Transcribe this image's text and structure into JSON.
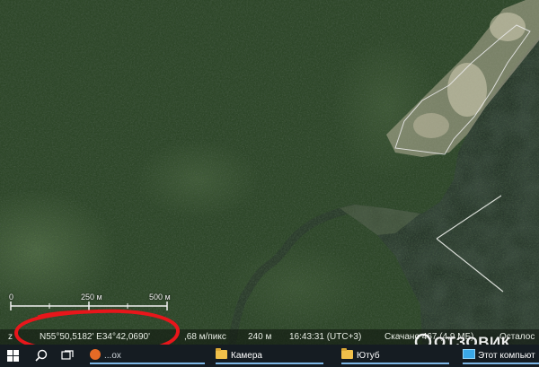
{
  "map": {
    "scale_bar": {
      "tick_0": "0",
      "tick_1": "250 м",
      "tick_2": "500 м"
    },
    "colors": {
      "forest": "#2b4327",
      "water": "#243128",
      "sand": "#cfc6ad"
    }
  },
  "status_bar": {
    "prefix": "z",
    "coordinates": "N55°50,5182' E34°42,0690'",
    "resolution": ",68 м/пикс",
    "altitude": "240 м",
    "time": "16:43:31 (UTC+3)",
    "download": "Скачано 467 (4,9 МБ)",
    "remaining": "Осталос"
  },
  "taskbar": {
    "items": [
      {
        "label": "...ox",
        "icon": "firefox-icon"
      },
      {
        "label": "Камера",
        "icon": "folder-icon"
      },
      {
        "label": "Ютуб",
        "icon": "folder-icon"
      },
      {
        "label": "Этот компьют",
        "icon": "computer-icon"
      }
    ]
  },
  "watermark": {
    "text": "ОТЗОВИК"
  },
  "annotation": {
    "color": "#e8161b",
    "shape": "hand-drawn-ellipse"
  }
}
